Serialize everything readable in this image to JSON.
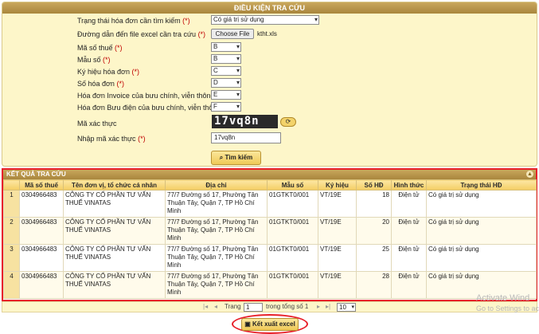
{
  "search": {
    "title": "ĐIỀU KIỆN TRA CỨU",
    "status_label": "Trạng thái hóa đơn cần tìm kiếm",
    "status_value": "Có giá trị sử dụng",
    "file_label": "Đường dẫn đến file excel cần tra cứu",
    "file_button": "Choose File",
    "file_name": "ktht.xls",
    "tax_label": "Mã số thuế",
    "tax_value": "B",
    "form_label": "Mẫu số",
    "form_value": "B",
    "symbol_label": "Ký hiệu hóa đơn",
    "symbol_value": "C",
    "number_label": "Số hóa đơn",
    "number_value": "D",
    "invoice_label": "Hóa đơn Invoice của bưu chính, viễn thông",
    "invoice_value": "E",
    "post_label": "Hóa đơn Bưu điện của bưu chính, viễn thông",
    "post_value": "F",
    "required_mark": "(*)",
    "captcha_label": "Mã xác thực",
    "captcha_text": "17vq8n",
    "captcha_input_label": "Nhập mã xác thực",
    "captcha_input_value": "17vq8n",
    "search_button": "Tìm kiếm"
  },
  "results": {
    "title": "KẾT QUẢ TRA CỨU",
    "columns": [
      "",
      "Mã số thuế",
      "Tên đơn vị, tổ chức cá nhân",
      "Địa chỉ",
      "Mẫu số",
      "Ký hiệu",
      "Số HĐ",
      "Hình thức",
      "Trạng thái HĐ"
    ],
    "rows": [
      [
        "1",
        "0304966483",
        "CÔNG TY CỔ PHẦN TƯ VẤN THUẾ VINATAS",
        "77/7 Đường số 17, Phường Tân Thuận Tây, Quận 7, TP Hồ Chí Minh",
        "01GTKT0/001",
        "VT/19E",
        "18",
        "Điện tử",
        "Có giá trị sử dụng"
      ],
      [
        "2",
        "0304966483",
        "CÔNG TY CỔ PHẦN TƯ VẤN THUẾ VINATAS",
        "77/7 Đường số 17, Phường Tân Thuận Tây, Quận 7, TP Hồ Chí Minh",
        "01GTKT0/001",
        "VT/19E",
        "20",
        "Điện tử",
        "Có giá trị sử dụng"
      ],
      [
        "3",
        "0304966483",
        "CÔNG TY CỔ PHẦN TƯ VẤN THUẾ VINATAS",
        "77/7 Đường số 17, Phường Tân Thuận Tây, Quận 7, TP Hồ Chí Minh",
        "01GTKT0/001",
        "VT/19E",
        "25",
        "Điện tử",
        "Có giá trị sử dụng"
      ],
      [
        "4",
        "0304966483",
        "CÔNG TY CỔ PHẦN TƯ VẤN THUẾ VINATAS",
        "77/7 Đường số 17, Phường Tân Thuận Tây, Quận 7, TP Hồ Chí Minh",
        "01GTKT0/001",
        "VT/19E",
        "28",
        "Điện tử",
        "Có giá trị sử dụng"
      ]
    ]
  },
  "pager": {
    "page_label": "Trang",
    "page_value": "1",
    "total_label": "trong tổng số 1",
    "page_size": "10"
  },
  "export": {
    "label": "Kết xuất excel"
  },
  "watermark": {
    "line1": "Activate Wind",
    "line2": "Go to Settings to ac"
  },
  "colors": {
    "accent": "#e8202a",
    "header": "#a9863d",
    "panel": "#fdf6c9"
  }
}
